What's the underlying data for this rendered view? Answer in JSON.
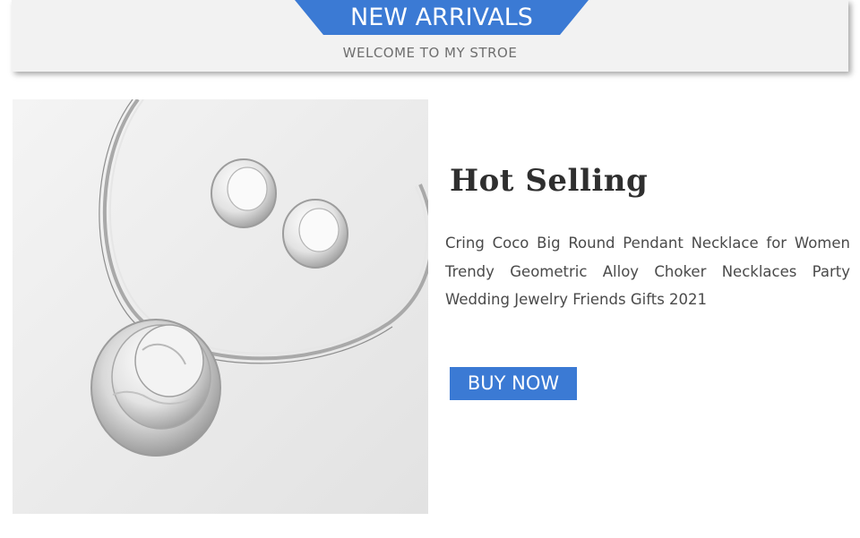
{
  "banner": {
    "title": "NEW ARRIVALS",
    "subtitle": "WELCOME TO MY STROE",
    "ribbon_color": "#3b7ad4"
  },
  "product": {
    "image_icon": "necklace-earrings-photo",
    "section_title": "Hot Selling",
    "description": "Cring Coco Big Round Pendant Necklace for Women Trendy Geometric Alloy Choker Necklaces Party Wedding Jewelry Friends Gifts 2021",
    "buy_label": "BUY NOW",
    "button_color": "#3b7ad4"
  }
}
